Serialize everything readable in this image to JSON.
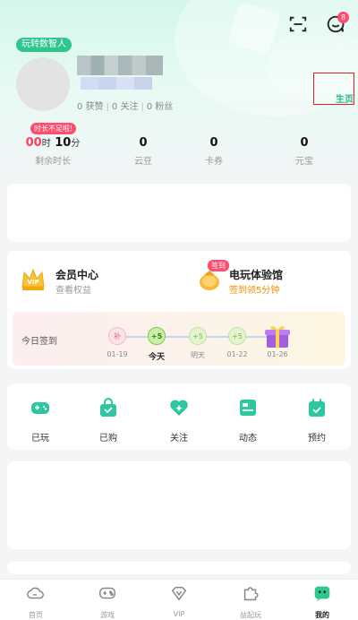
{
  "header": {
    "message_badge": "8",
    "user_tag": "玩转数智人",
    "social": {
      "likes": "0 获赞",
      "following": "0 关注",
      "fans": "0 粉丝"
    },
    "homepage_link": "主页"
  },
  "stats": {
    "time_warning": "时长不足啦!",
    "time": {
      "hours": "00",
      "hour_unit": "时",
      "minutes": "10",
      "minute_unit": "分",
      "label": "剩余时长"
    },
    "yundou": {
      "value": "0",
      "label": "云豆"
    },
    "kaquan": {
      "value": "0",
      "label": "卡券"
    },
    "yuanbao": {
      "value": "0",
      "label": "元宝"
    }
  },
  "member": {
    "title": "会员中心",
    "subtitle": "查看权益",
    "vip_icon_text": "VIP"
  },
  "game_hall": {
    "tag": "签到",
    "title": "电玩体验馆",
    "subtitle": "签到领5分钟"
  },
  "checkin": {
    "label": "今日签到",
    "days": [
      {
        "badge": "补",
        "date": "01-19"
      },
      {
        "badge": "+5",
        "date": "今天"
      },
      {
        "badge": "+5",
        "date": "明天"
      },
      {
        "badge": "+5",
        "date": "01-22"
      },
      {
        "badge": "",
        "date": "01-26"
      }
    ]
  },
  "tools": [
    {
      "label": "已玩",
      "icon": "gamepad-icon"
    },
    {
      "label": "已购",
      "icon": "shopping-bag-icon"
    },
    {
      "label": "关注",
      "icon": "heart-icon"
    },
    {
      "label": "动态",
      "icon": "feed-icon"
    },
    {
      "label": "预约",
      "icon": "calendar-check-icon"
    }
  ],
  "tabbar": [
    {
      "label": "首页",
      "icon": "cloud-icon"
    },
    {
      "label": "游戏",
      "icon": "gamepad-icon"
    },
    {
      "label": "VIP",
      "icon": "vip-diamond-icon"
    },
    {
      "label": "益起玩",
      "icon": "puzzle-icon"
    },
    {
      "label": "我的",
      "icon": "profile-chat-icon",
      "active": true
    }
  ],
  "colors": {
    "brand_green": "#2fc58f",
    "alert_red": "#ff4d6d",
    "orange": "#ff8a00",
    "highlight_box": "#e02020"
  }
}
